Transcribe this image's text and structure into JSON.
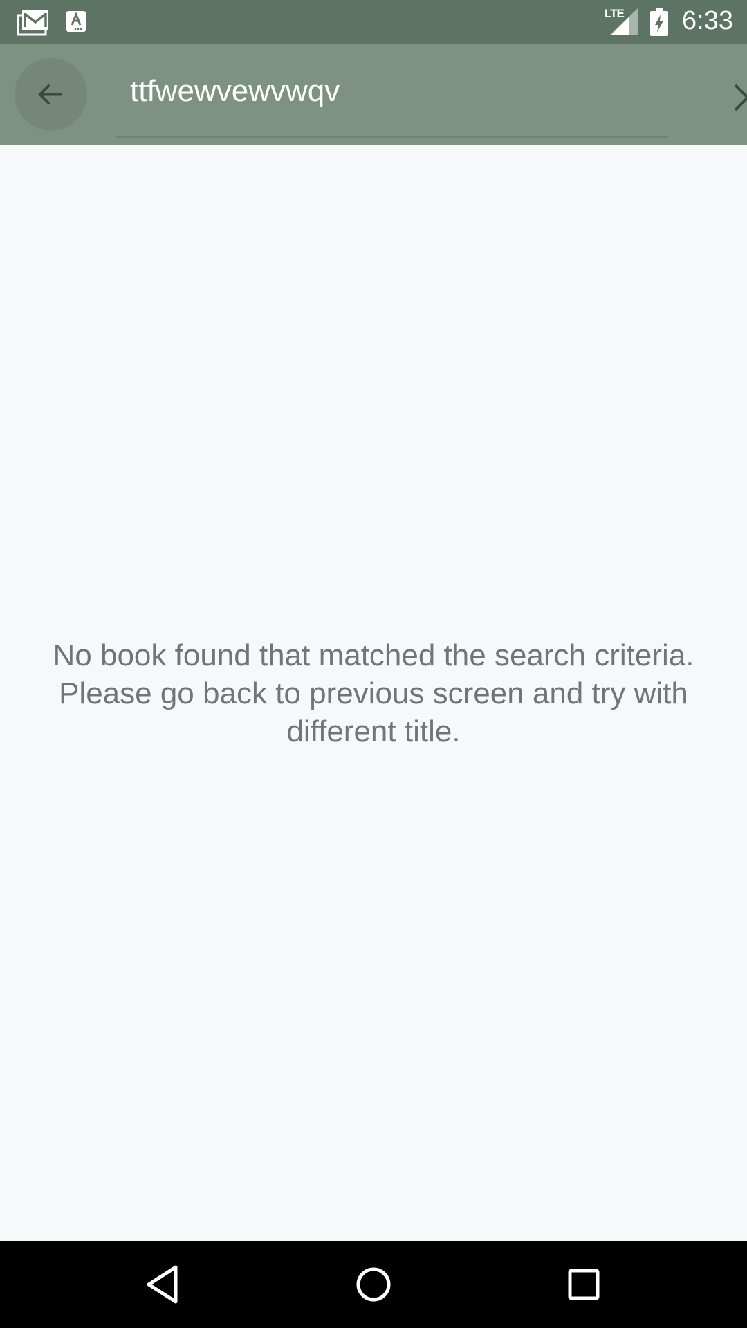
{
  "status_bar": {
    "time": "6:33",
    "network_label": "LTE",
    "icons": [
      "gmail-icon",
      "font-a-icon",
      "signal-icon",
      "battery-charging-icon"
    ]
  },
  "app_bar": {
    "back_icon": "arrow-back-icon",
    "search_value": "ttfwewvewvwqv",
    "clear_icon": "close-icon",
    "color": "#7d9282"
  },
  "content": {
    "empty_message": "No book found that matched the search criteria. Please go back to previous screen and try with different title."
  },
  "nav_bar": {
    "icons": [
      "triangle-back-icon",
      "circle-home-icon",
      "square-recents-icon"
    ]
  }
}
